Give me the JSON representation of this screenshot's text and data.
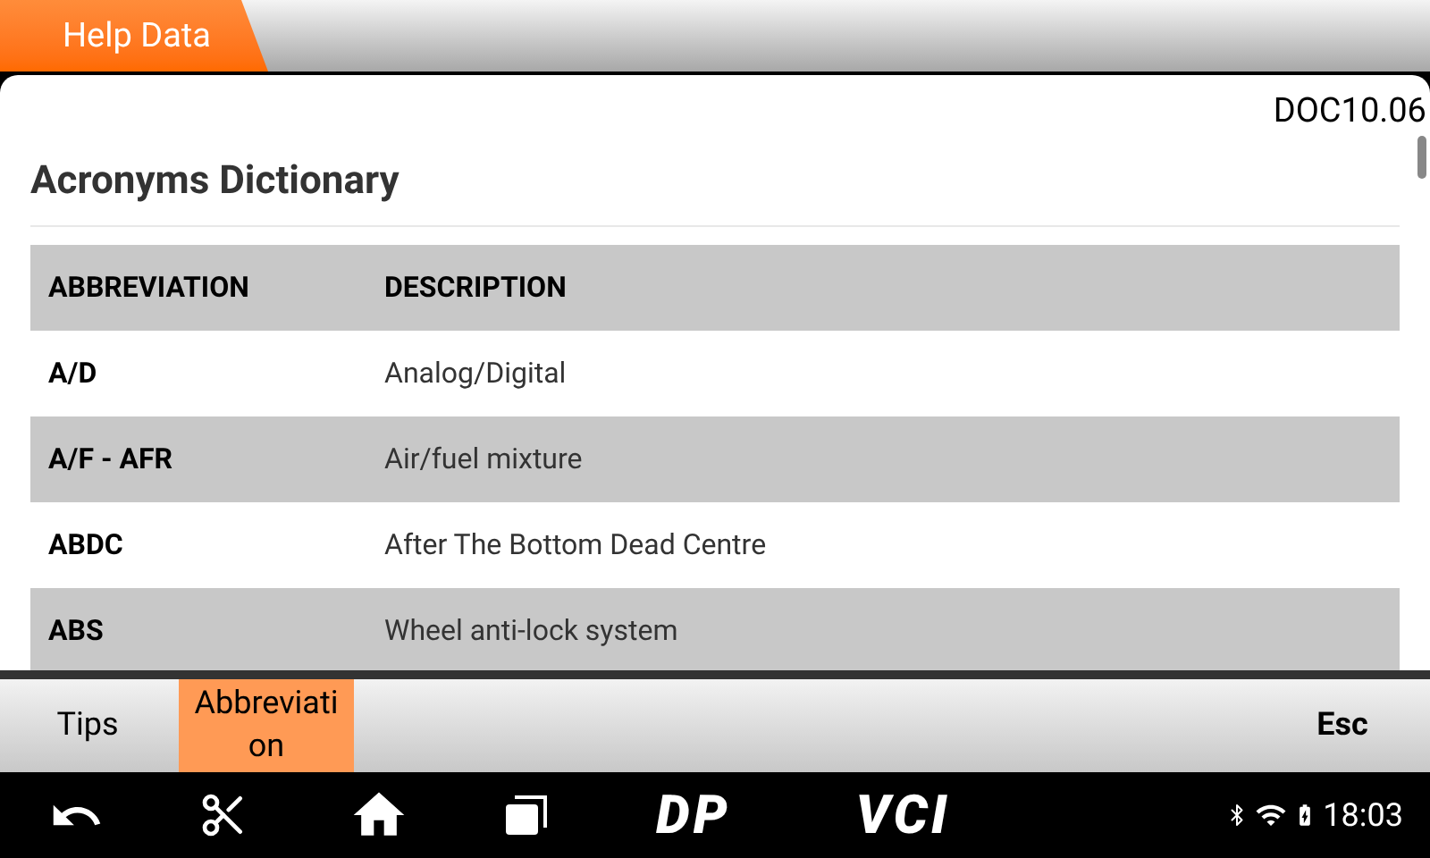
{
  "header": {
    "tab": "Help Data"
  },
  "document": {
    "code": "DOC10.06",
    "title": "Acronyms Dictionary",
    "table": {
      "columns": [
        "ABBREVIATION",
        "DESCRIPTION"
      ],
      "rows": [
        {
          "abbreviation": "A/D",
          "description": "Analog/Digital"
        },
        {
          "abbreviation": "A/F - AFR",
          "description": "Air/fuel mixture"
        },
        {
          "abbreviation": "ABDC",
          "description": "After The Bottom Dead Centre"
        },
        {
          "abbreviation": "ABS",
          "description": "Wheel anti-lock system"
        }
      ]
    }
  },
  "toolbar": {
    "left": [
      {
        "label": "Tips",
        "selected": false
      },
      {
        "label": "Abbreviati on",
        "selected": true
      }
    ],
    "right": [
      {
        "label": "Esc",
        "selected": false
      }
    ]
  },
  "nav_bar": {
    "logos": [
      "DP",
      "VCI"
    ],
    "time": "18:03"
  }
}
